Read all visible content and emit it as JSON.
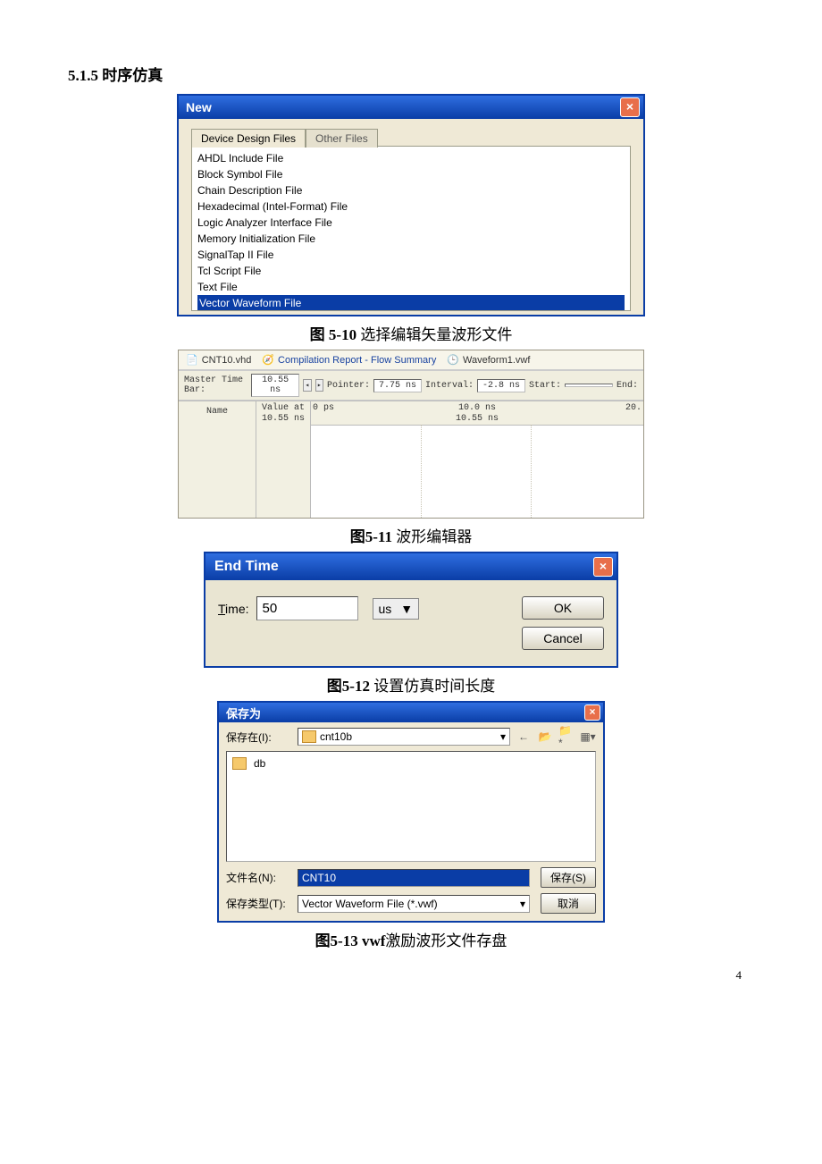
{
  "page_number": "4",
  "section_heading": "5.1.5  时序仿真",
  "captions": {
    "fig5_10_strong": "图 5-10",
    "fig5_10_rest": "  选择编辑矢量波形文件",
    "fig5_11_strong": "图5-11",
    "fig5_11_rest": "  波形编辑器",
    "fig5_12_strong": "图5-12",
    "fig5_12_rest": "  设置仿真时间长度",
    "fig5_13_strong": "图5-13 vwf",
    "fig5_13_rest": "激励波形文件存盘"
  },
  "new_dialog": {
    "title": "New",
    "tabs": {
      "active": "Device Design Files",
      "inactive": "Other Files"
    },
    "items": [
      "AHDL Include File",
      "Block Symbol File",
      "Chain Description File",
      "Hexadecimal (Intel-Format) File",
      "Logic Analyzer Interface File",
      "Memory Initialization File",
      "SignalTap II File",
      "Tcl Script File",
      "Text File",
      "Vector Waveform File"
    ],
    "selected_index": 9
  },
  "wf_editor": {
    "tabs": {
      "vhd": "CNT10.vhd",
      "report": "Compilation Report - Flow Summary",
      "wave": "Waveform1.vwf"
    },
    "master_label": "Master Time Bar:",
    "master_value": "10.55 ns",
    "pointer_label": "Pointer:",
    "pointer_value": "7.75 ns",
    "interval_label": "Interval:",
    "interval_value": "-2.8 ns",
    "start_label": "Start:",
    "start_value": "",
    "end_label": "End:",
    "end_value": "",
    "name_header": "Name",
    "value_header1": "Value at",
    "value_header2": "10.55 ns",
    "scale_0": "0 ps",
    "scale_mid": "10.0 ns",
    "scale_cursor": "10.55 ns",
    "scale_right": "20."
  },
  "end_time": {
    "title": "End Time",
    "label": "Time:",
    "value": "50",
    "unit": "us",
    "ok": "OK",
    "cancel": "Cancel"
  },
  "save_dialog": {
    "title": "保存为",
    "save_in_label": "保存在(I):",
    "save_in_value": "cnt10b",
    "folder_item": "db",
    "filename_label": "文件名(N):",
    "filename_value": "CNT10",
    "filetype_label": "保存类型(T):",
    "filetype_value": "Vector Waveform File (*.vwf)",
    "save_btn": "保存(S)",
    "cancel_btn": "取消"
  }
}
